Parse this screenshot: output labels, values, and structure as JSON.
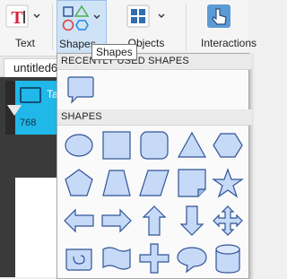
{
  "ribbon": {
    "text_label": "Text",
    "shapes_label": "Shapes",
    "objects_label": "Objects",
    "interaction_label": "Interactions",
    "tooltip": "Shapes"
  },
  "document": {
    "tab_title": "untitled6",
    "slide_tab_text": "Ta",
    "position_value": "768"
  },
  "dropdown": {
    "recent_header": "RECENTLY USED SHAPES",
    "shapes_header": "SHAPES",
    "recent_shapes": [
      "speech-bubble"
    ],
    "shapes": [
      "ellipse",
      "rectangle",
      "rounded-rectangle",
      "triangle",
      "hexagon",
      "pentagon",
      "trapezoid",
      "parallelogram",
      "folded-corner",
      "star",
      "arrow-left",
      "arrow-right",
      "arrow-up",
      "arrow-down",
      "arrow-quad",
      "scroll",
      "wave",
      "plus",
      "cloud-callout",
      "cylinder"
    ]
  },
  "colors": {
    "shape_fill": "#c6d9f7",
    "shape_stroke": "#2f5597",
    "accent": "#1fb8e8"
  }
}
